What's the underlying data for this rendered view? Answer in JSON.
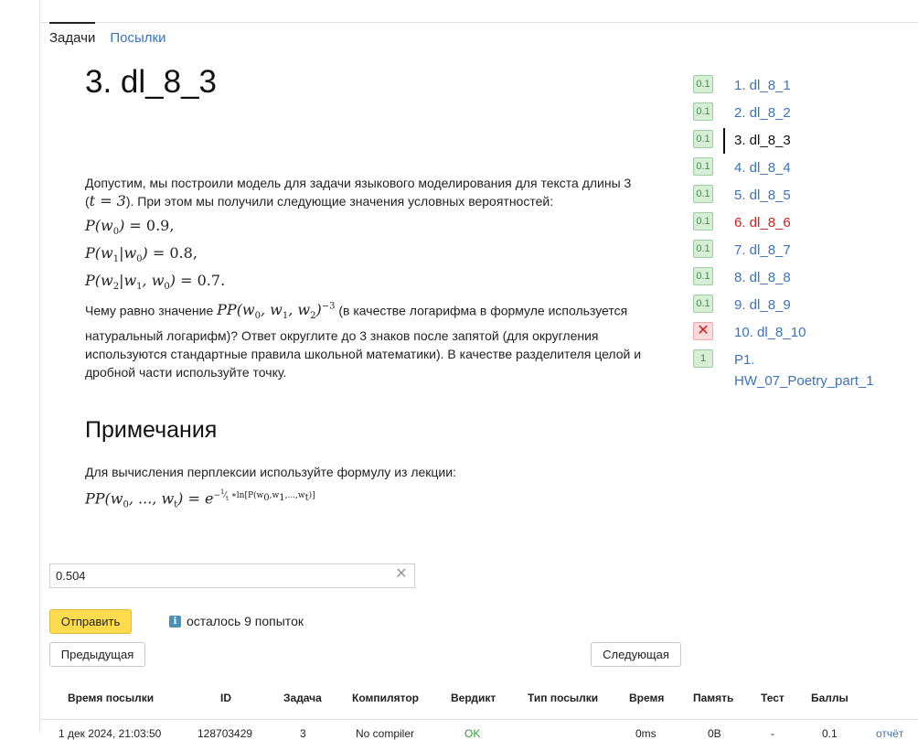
{
  "tabs": [
    {
      "label": "Задачи",
      "active": true
    },
    {
      "label": "Посылки",
      "active": false
    }
  ],
  "problem": {
    "title": "3. dl_8_3",
    "statement_intro": "Допустим, мы построили модель для задачи языкового моделирования для текста длины 3 (",
    "statement_intro_math": "t = 3",
    "statement_intro_end": "). При этом мы получили следующие значения условных вероятностей:",
    "formulas": [
      "P(w0) = 0.9,",
      "P(w1|w0) = 0.8,",
      "P(w2|w1, w0) = 0.7."
    ],
    "question_start": "Чему равно значение ",
    "question_math": "PP(w0, w1, w2)^−3",
    "question_end": " (в качестве логарифма в формуле используется натуральный логарифм)? Ответ округлите до 3 знаков после запятой (для округления используются стандартные правила школьной математики). В качестве разделителя целой и дробной части используйте точку.",
    "notes_title": "Примечания",
    "notes_text": "Для вычисления перплексии используйте формулу из лекции:",
    "notes_formula": "PP(w0, ..., wt) = e^(−1/t * ln[P(w0, w1, ..., wt)])"
  },
  "answer": {
    "value": "0.504"
  },
  "buttons": {
    "submit": "Отправить",
    "prev": "Предыдущая",
    "next": "Следующая"
  },
  "attempts_left": "осталось 9 попыток",
  "table": {
    "headers": [
      "Время посылки",
      "ID",
      "Задача",
      "Компилятор",
      "Вердикт",
      "Тип посылки",
      "Время",
      "Память",
      "Тест",
      "Баллы"
    ],
    "rows": [
      [
        "1 дек 2024, 21:03:50",
        "128703429",
        "3",
        "No compiler",
        "OK",
        "",
        "0ms",
        "0B",
        "-",
        "0.1",
        "отчёт"
      ]
    ]
  },
  "tasks": [
    {
      "label": "1. dl_8_1",
      "score": "0.1",
      "status": "ok"
    },
    {
      "label": "2. dl_8_2",
      "score": "0.1",
      "status": "ok"
    },
    {
      "label": "3. dl_8_3",
      "score": "0.1",
      "status": "current"
    },
    {
      "label": "4. dl_8_4",
      "score": "0.1",
      "status": "ok"
    },
    {
      "label": "5. dl_8_5",
      "score": "0.1",
      "status": "ok"
    },
    {
      "label": "6. dl_8_6",
      "score": "0.1",
      "status": "failed"
    },
    {
      "label": "7. dl_8_7",
      "score": "0.1",
      "status": "ok"
    },
    {
      "label": "8. dl_8_8",
      "score": "0.1",
      "status": "ok"
    },
    {
      "label": "9. dl_8_9",
      "score": "0.1",
      "status": "ok"
    },
    {
      "label": "10. dl_8_10",
      "score": "✕",
      "status": "rejected"
    },
    {
      "label": "P1.",
      "label2": "HW_07_Poetry_part_1",
      "score": "1",
      "status": "ok"
    }
  ],
  "colors": {
    "link": "#3b73b9",
    "failed": "#d21f1f",
    "accent_button": "#ffdb4d",
    "badge_ok_bg": "#d6edd6",
    "badge_fail_bg": "#fadada",
    "verdict_ok": "#2f9a2f"
  }
}
